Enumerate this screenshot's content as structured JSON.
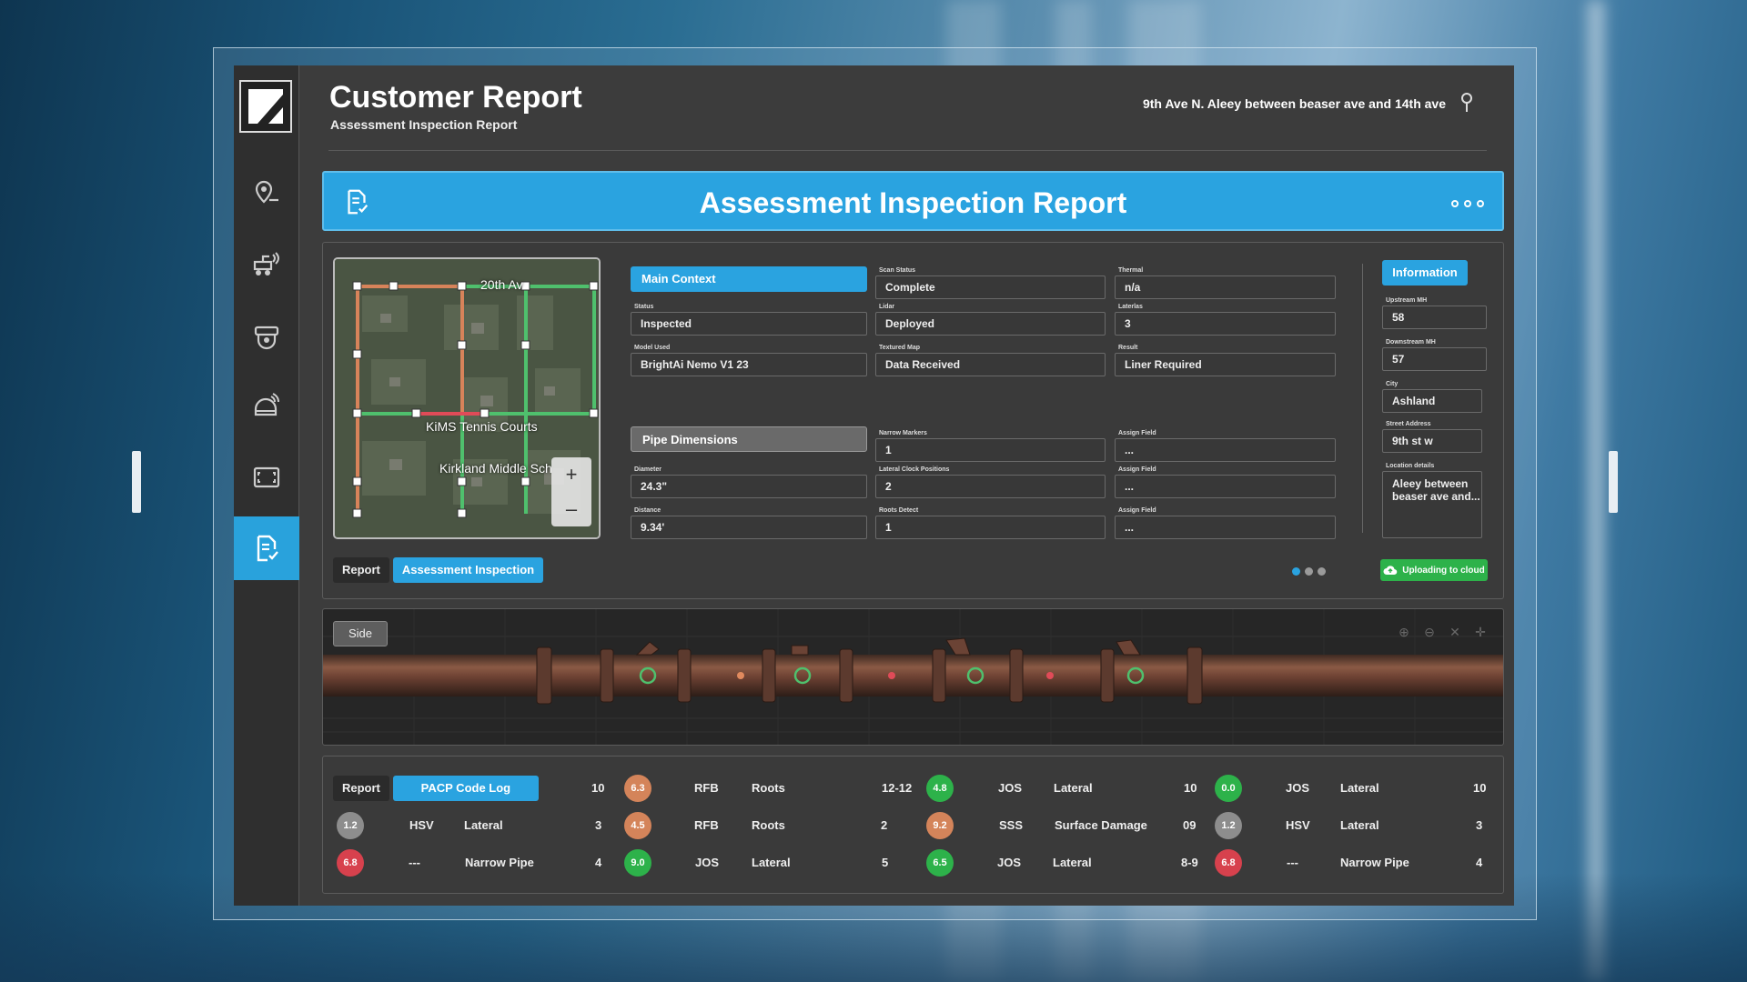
{
  "header": {
    "title": "Customer Report",
    "subtitle": "Assessment Inspection Report",
    "address": "9th Ave N. Aleey between beaser ave and 14th ave"
  },
  "sidebar": {
    "items": [
      {
        "name": "location"
      },
      {
        "name": "robot"
      },
      {
        "name": "camera"
      },
      {
        "name": "helmet"
      },
      {
        "name": "scan"
      },
      {
        "name": "report",
        "active": true
      }
    ]
  },
  "banner": {
    "title": "Assessment Inspection Report"
  },
  "map": {
    "label_street": "20th Av",
    "label_courts": "KiMS Tennis Courts",
    "label_school": "Kirkland Middle Sch"
  },
  "top_tabs": {
    "report": "Report",
    "assessment": "Assessment Inspection"
  },
  "main_context": {
    "title": "Main Context",
    "fields": [
      {
        "label": "Status",
        "value": "Inspected"
      },
      {
        "label": "Model Used",
        "value": "BrightAi Nemo V1 23"
      },
      {
        "label": "Scan Status",
        "value": "Complete"
      },
      {
        "label": "Lidar",
        "value": "Deployed"
      },
      {
        "label": "Textured Map",
        "value": "Data Received"
      },
      {
        "label": "Thermal",
        "value": "n/a"
      },
      {
        "label": "Laterlas",
        "value": "3"
      },
      {
        "label": "Result",
        "value": "Liner Required"
      }
    ]
  },
  "pipe_dimensions": {
    "title": "Pipe Dimensions",
    "fields": [
      {
        "label": "Diameter",
        "value": "24.3\""
      },
      {
        "label": "Distance",
        "value": "9.34'"
      },
      {
        "label": "Narrow Markers",
        "value": "1"
      },
      {
        "label": "Lateral Clock Positions",
        "value": "2"
      },
      {
        "label": "Roots Detect",
        "value": "1"
      },
      {
        "label": "Assign Field",
        "value": "..."
      },
      {
        "label": "Assign Field",
        "value": "..."
      },
      {
        "label": "Assign Field",
        "value": "..."
      }
    ]
  },
  "information": {
    "title": "Information",
    "fields": [
      {
        "label": "Upstream MH",
        "value": "58"
      },
      {
        "label": "Downstream MH",
        "value": "57"
      },
      {
        "label": "City",
        "value": "Ashland"
      },
      {
        "label": "Street Address",
        "value": "9th st w"
      },
      {
        "label": "Location details",
        "value": "Aleey between beaser ave and..."
      }
    ]
  },
  "upload": {
    "label": "Uploading to cloud"
  },
  "side_view": {
    "label": "Side"
  },
  "bottom_tabs": {
    "report": "Report",
    "pacp": "PACP Code Log"
  },
  "colors": {
    "accent": "#2aa3e0",
    "green": "#2db24a",
    "orange": "#d4845a",
    "red": "#d7414d",
    "gray": "#8d8d8d"
  },
  "code_log": {
    "row1": {
      "a_count": "10",
      "a_score": "6.3",
      "a_code": "RFB",
      "a_desc": "Roots",
      "b_count": "12-12",
      "b_score": "4.8",
      "b_code": "JOS",
      "b_desc": "Lateral",
      "c_count": "10",
      "c_score": "0.0",
      "c_code": "JOS",
      "c_desc": "Lateral",
      "d_count": "10"
    },
    "row2": {
      "lead_score": "1.2",
      "lead_code": "HSV",
      "lead_desc": "Lateral",
      "a_count": "3",
      "a_score": "4.5",
      "a_code": "RFB",
      "a_desc": "Roots",
      "b_count": "2",
      "b_score": "9.2",
      "b_code": "SSS",
      "b_desc": "Surface Damage",
      "c_count": "09",
      "c_score": "1.2",
      "c_code": "HSV",
      "c_desc": "Lateral",
      "d_count": "3"
    },
    "row3": {
      "lead_score": "6.8",
      "lead_code": "---",
      "lead_desc": "Narrow Pipe",
      "a_count": "4",
      "a_score": "9.0",
      "a_code": "JOS",
      "a_desc": "Lateral",
      "b_count": "5",
      "b_score": "6.5",
      "b_code": "JOS",
      "b_desc": "Lateral",
      "c_count": "8-9",
      "c_score": "6.8",
      "c_code": "---",
      "c_desc": "Narrow Pipe",
      "d_count": "4"
    }
  }
}
